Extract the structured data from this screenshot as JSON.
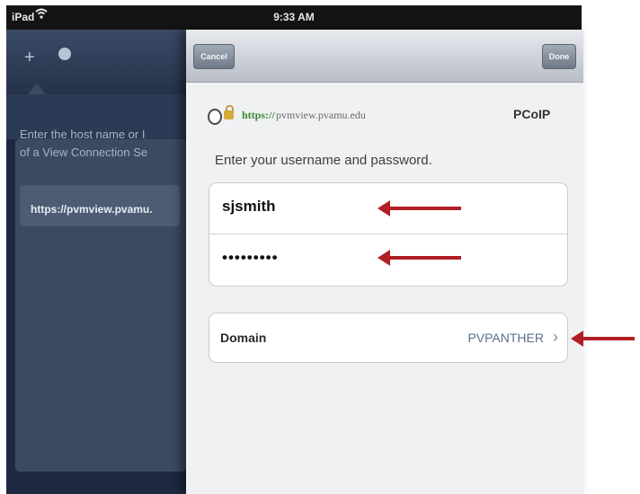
{
  "status_bar": {
    "carrier": "iPad",
    "time": "9:33 AM"
  },
  "background_app": {
    "instruction_lines": [
      "Enter the host name or I",
      "of a View Connection Se"
    ],
    "server_url": "https://pvmview.pvamu."
  },
  "sheet": {
    "cancel_label": "Cancel",
    "done_label": "Done",
    "url_secure": "https://",
    "url_rest": "pvmview.pvamu.edu",
    "brand": "PCoIP",
    "prompt": "Enter your username and password.",
    "username_value": "sjsmith",
    "password_value": "•••••••••",
    "domain_label": "Domain",
    "domain_value": "PVPANTHER"
  },
  "colors": {
    "annotation_arrow": "#b01f24",
    "background_app": "#1c2940",
    "sheet_bg": "#f0f1f3"
  },
  "icons": [
    "wifi-icon",
    "plus-icon",
    "person-icon",
    "info-icon",
    "lock-icon",
    "chevron-right-icon",
    "arrow-left-icon"
  ]
}
